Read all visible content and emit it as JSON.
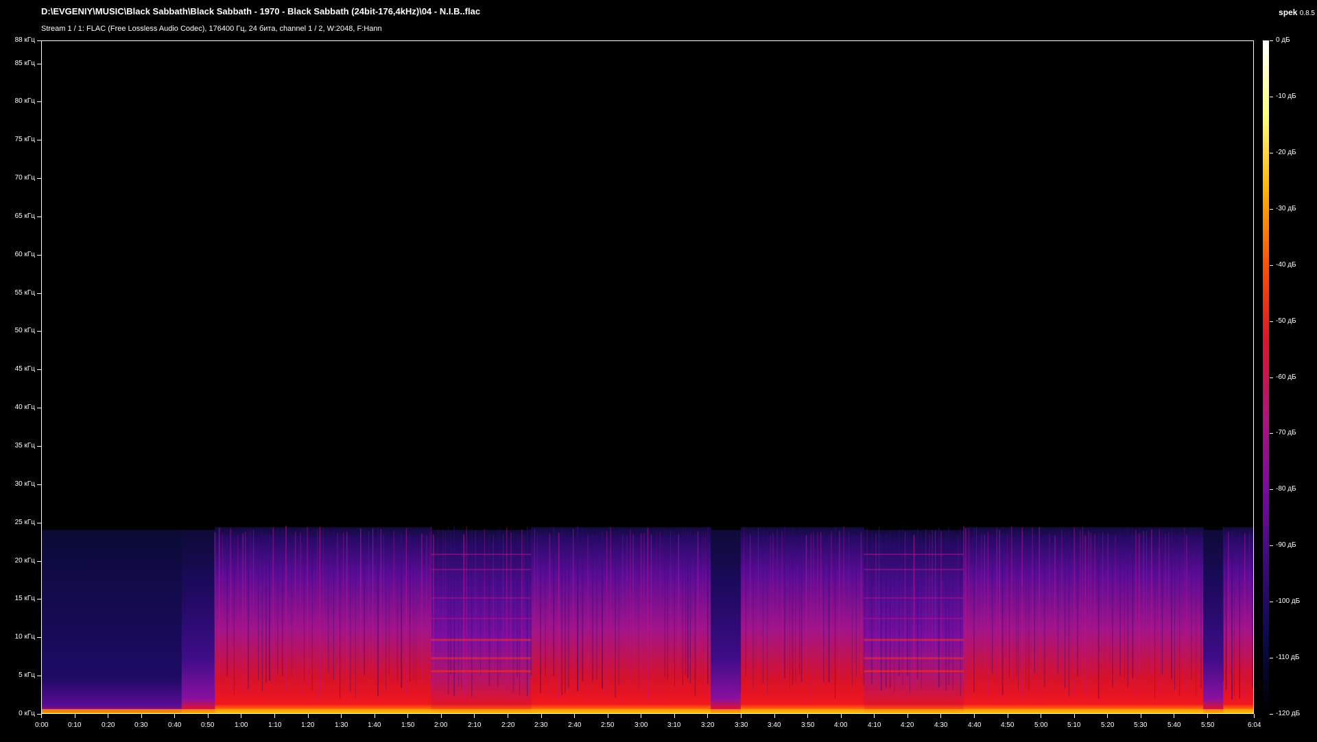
{
  "header": {
    "file_path": "D:\\EVGENIY\\MUSIC\\Black Sabbath\\Black Sabbath - 1970 - Black Sabbath (24bit-176,4kHz)\\04 - N.I.B..flac",
    "stream_info": "Stream 1 / 1: FLAC (Free Lossless Audio Codec), 176400 Гц, 24 бита, channel 1 / 2, W:2048, F:Hann",
    "app_name": "spek",
    "app_version": "0.8.5"
  },
  "colors": {
    "background": "#000000",
    "foreground": "#ffffff",
    "palette": [
      "#000000",
      "#0a0a4a",
      "#3b0a7a",
      "#7a0aa0",
      "#b4127a",
      "#e0142a",
      "#ff5000",
      "#ffb400",
      "#ffff78",
      "#ffffff"
    ]
  },
  "chart_data": {
    "type": "heatmap",
    "title": "",
    "xlabel": "",
    "ylabel": "",
    "x_unit": "time (m:ss)",
    "y_unit": "кГц",
    "xlim": [
      0,
      364
    ],
    "ylim": [
      0,
      88
    ],
    "y_ticks": [
      "0 кГц",
      "5 кГц",
      "10 кГц",
      "15 кГц",
      "20 кГц",
      "25 кГц",
      "30 кГц",
      "35 кГц",
      "40 кГц",
      "45 кГц",
      "50 кГц",
      "55 кГц",
      "60 кГц",
      "65 кГц",
      "70 кГц",
      "75 кГц",
      "80 кГц",
      "85 кГц",
      "88 кГц"
    ],
    "y_tick_values": [
      0,
      5,
      10,
      15,
      20,
      25,
      30,
      35,
      40,
      45,
      50,
      55,
      60,
      65,
      70,
      75,
      80,
      85,
      88
    ],
    "x_ticks": [
      "0:00",
      "0:10",
      "0:20",
      "0:30",
      "0:40",
      "0:50",
      "1:00",
      "1:10",
      "1:20",
      "1:30",
      "1:40",
      "1:50",
      "2:00",
      "2:10",
      "2:20",
      "2:30",
      "2:40",
      "2:50",
      "3:00",
      "3:10",
      "3:20",
      "3:30",
      "3:40",
      "3:50",
      "4:00",
      "4:10",
      "4:20",
      "4:30",
      "4:40",
      "4:50",
      "5:00",
      "5:10",
      "5:20",
      "5:30",
      "5:40",
      "5:50",
      "6:04"
    ],
    "x_tick_values": [
      0,
      10,
      20,
      30,
      40,
      50,
      60,
      70,
      80,
      90,
      100,
      110,
      120,
      130,
      140,
      150,
      160,
      170,
      180,
      190,
      200,
      210,
      220,
      230,
      240,
      250,
      260,
      270,
      280,
      290,
      300,
      310,
      320,
      330,
      340,
      350,
      364
    ],
    "color_scale": {
      "label_unit": "дБ",
      "range": [
        -120,
        0
      ],
      "ticks": [
        "0 дБ",
        "-10 дБ",
        "-20 дБ",
        "-30 дБ",
        "-40 дБ",
        "-50 дБ",
        "-60 дБ",
        "-70 дБ",
        "-80 дБ",
        "-90 дБ",
        "-100 дБ",
        "-110 дБ",
        "-120 дБ"
      ],
      "tick_values": [
        0,
        -10,
        -20,
        -30,
        -40,
        -50,
        -60,
        -70,
        -80,
        -90,
        -100,
        -110,
        -120
      ]
    },
    "content_cutoff_khz": 24,
    "sections": [
      {
        "start": 0,
        "end": 42,
        "intensity": 0.28
      },
      {
        "start": 42,
        "end": 52,
        "intensity": 0.45
      },
      {
        "start": 52,
        "end": 117,
        "intensity": 0.78
      },
      {
        "start": 117,
        "end": 147,
        "intensity": 0.62
      },
      {
        "start": 147,
        "end": 201,
        "intensity": 0.76
      },
      {
        "start": 201,
        "end": 210,
        "intensity": 0.42
      },
      {
        "start": 210,
        "end": 247,
        "intensity": 0.78
      },
      {
        "start": 247,
        "end": 277,
        "intensity": 0.62
      },
      {
        "start": 277,
        "end": 349,
        "intensity": 0.78
      },
      {
        "start": 349,
        "end": 355,
        "intensity": 0.4
      },
      {
        "start": 355,
        "end": 364,
        "intensity": 0.72
      }
    ]
  }
}
